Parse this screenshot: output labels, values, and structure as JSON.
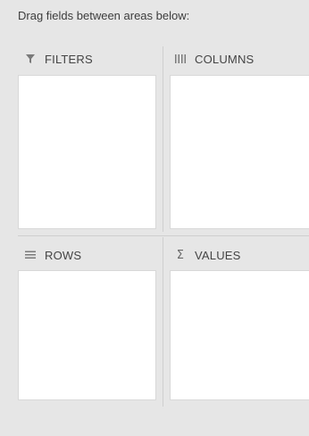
{
  "instruction": "Drag fields between areas below:",
  "areas": {
    "filters": {
      "label": "FILTERS",
      "icon": "filter-icon"
    },
    "columns": {
      "label": "COLUMNS",
      "icon": "columns-icon"
    },
    "rows": {
      "label": "ROWS",
      "icon": "rows-icon"
    },
    "values": {
      "label": "VALUES",
      "icon": "sigma-icon"
    }
  }
}
